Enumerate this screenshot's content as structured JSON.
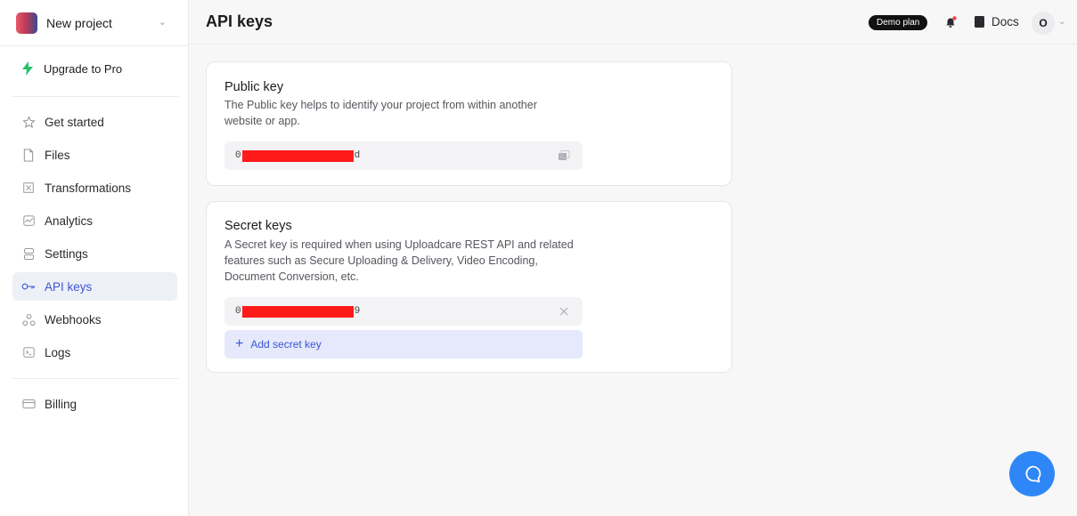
{
  "sidebar": {
    "project_name": "New project",
    "upgrade_label": "Upgrade to Pro",
    "items": [
      {
        "label": "Get started",
        "icon": "star-icon"
      },
      {
        "label": "Files",
        "icon": "file-icon"
      },
      {
        "label": "Transformations",
        "icon": "crop-icon"
      },
      {
        "label": "Analytics",
        "icon": "chart-icon"
      },
      {
        "label": "Settings",
        "icon": "settings-icon"
      },
      {
        "label": "API keys",
        "icon": "key-icon"
      },
      {
        "label": "Webhooks",
        "icon": "webhook-icon"
      },
      {
        "label": "Logs",
        "icon": "terminal-icon"
      }
    ],
    "billing_label": "Billing",
    "active_item": "API keys"
  },
  "header": {
    "title": "API keys",
    "plan_badge": "Demo plan",
    "docs_label": "Docs",
    "avatar_initial": "O"
  },
  "public_key": {
    "title": "Public key",
    "description_line1": "The Public key helps to identify your project from within another",
    "description_line2": "website or app.",
    "key_prefix": "0",
    "key_suffix": "d"
  },
  "secret_keys": {
    "title": "Secret keys",
    "description_line1": "A Secret key is required when using Uploadcare REST API and related",
    "description_line2": "features such as Secure Uploading & Delivery, Video Encoding,",
    "description_line3": "Document Conversion, etc.",
    "key_prefix": "0",
    "key_suffix": "9",
    "add_label": "Add secret key"
  },
  "colors": {
    "accent": "#3c55d6",
    "redaction": "#ff1a1a",
    "chat_button": "#2f86f6"
  }
}
